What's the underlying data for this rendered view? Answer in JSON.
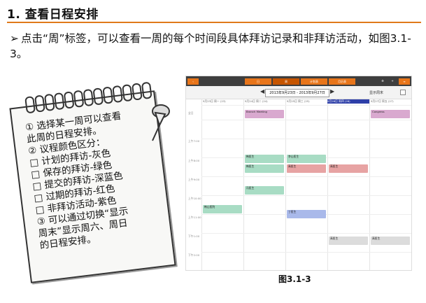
{
  "heading": "1. 查看日程安排",
  "bullet": {
    "arrow": "➢",
    "text": "点击“周”标签，可以查看一周的每个时间段具体拜访记录和非拜访活动，如图3.1-3。"
  },
  "note": {
    "lines": [
      "① 选择某一周可以查看",
      "此周的日程安排。",
      "② 议程颜色区分：",
      "□  计划的拜访-灰色",
      "□  保存的拜访-绿色",
      "□  提交的拜访-深蓝色",
      "□  过期的拜访-红色",
      "□  非拜访活动-紫色",
      "③ 可以通过切换“显示",
      "周末”显示周六、周日",
      "的日程安排。"
    ]
  },
  "screenshot": {
    "tabs": [
      "日",
      "周",
      "计划表",
      "月历表"
    ],
    "date_range": "2013年9月23日 - 2013年9月27日",
    "show_weekend": "显示周末",
    "day_headers": [
      "9月23日 周一 (23)",
      "9月24日 周二 (24)",
      "9月25日 周三 (25)",
      "9月26日 周四 (26)",
      "9月27日 周五 (27)"
    ],
    "time_labels": [
      "全日",
      "上午7:00",
      "上午8:00",
      "上午9:00",
      "上午10:00",
      "上午11:00",
      "下午1:00",
      "下午2:00"
    ],
    "events": [
      {
        "label": "Branch Meeting",
        "color": "#d9a9cf"
      },
      {
        "label": "Congress",
        "color": "#d9a9cf"
      },
      {
        "label": "韩医生",
        "color": "#a8dcc4"
      },
      {
        "label": "韩医生",
        "color": "#a8dcc4"
      },
      {
        "label": "李山医生",
        "color": "#a8dcc4"
      },
      {
        "label": "高医生",
        "color": "#e7a3a3"
      },
      {
        "label": "高医生",
        "color": "#e7a3a3"
      },
      {
        "label": "冯医生",
        "color": "#a8dcc4"
      },
      {
        "label": "韩山医院",
        "color": "#a8dcc4"
      },
      {
        "label": "丁医生",
        "color": "#a9b9ea"
      },
      {
        "label": "高医生",
        "color": "#dcdcdc"
      },
      {
        "label": "高医生",
        "color": "#dcdcdc"
      }
    ]
  },
  "caption": "图3.1-3"
}
